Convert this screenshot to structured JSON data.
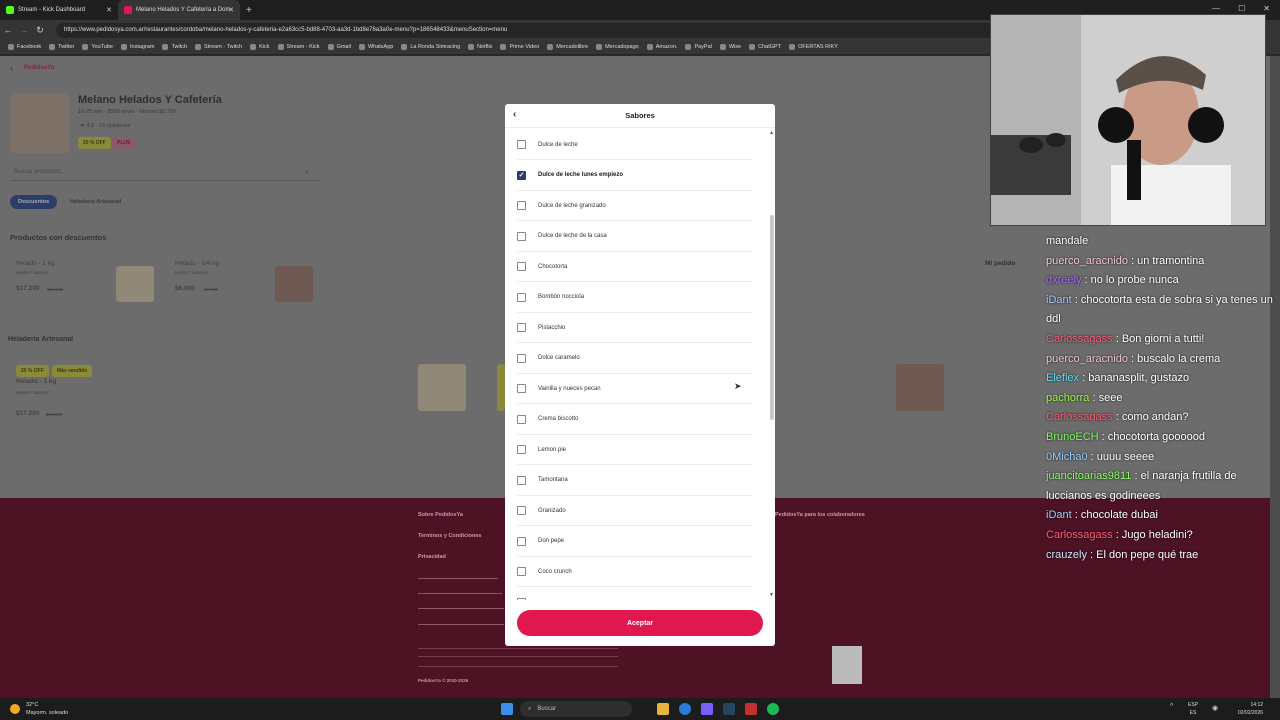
{
  "browser": {
    "tabs": [
      {
        "label": "Stream - Kick Dashboard",
        "active": false
      },
      {
        "label": "Melano Helados Y Cafetería a Dom",
        "active": true
      }
    ],
    "url": "https://www.pedidosya.com.ar/restaurantes/cordoba/melano-helados-y-cafeteria-e2a63cc5-bd88-4703-aa3d-1bd8e76a3a0e-menu?p=186548433&menuSection=menu",
    "bookmarks": [
      "Facebook",
      "Twitter",
      "YouTube",
      "Instagram",
      "Twitch",
      "Stream - Twitch",
      "Kick",
      "Stream - Kick",
      "Gmail",
      "WhatsApp",
      "La Ronda Simracing",
      "Netflix",
      "Prime Video",
      "Mercadolibre",
      "Mercadopago",
      "Amazon.",
      "PayPal",
      "Wise",
      "ChatGPT",
      "OFERTAS RIKY"
    ]
  },
  "store": {
    "brand": "PedidosYa",
    "name": "Melano Helados Y Cafetería",
    "meta": "10-25 min · $569 envío · Mínimo $5.799",
    "rating": "4.8",
    "reviews": "16 opiniones",
    "badge_off": "20 % OFF",
    "badge_plus": "PLUS",
    "search_placeholder": "Buscar productos...",
    "chips": [
      "Descuentos",
      "Heladería Artesanal"
    ],
    "section_discounts": "Productos con descuentos",
    "section_artesanal": "Heladería Artesanal",
    "mi_pedido": "Mi pedido",
    "products": [
      {
        "name": "Helado - 1 kg",
        "desc": "Hasta 4 sabores",
        "price": "$17.200",
        "old": "$21.500"
      },
      {
        "name": "Helado - 1/4 kg",
        "desc": "Hasta 2 sabores",
        "price": "$6.000",
        "old": "$7.500"
      }
    ],
    "artesanal_product": {
      "badge1": "20 % OFF",
      "badge2": "Más vendido",
      "name": "Helado - 1 kg",
      "desc": "Hasta 4 sabores",
      "price": "$17.200",
      "old": "$21.500"
    },
    "footer": {
      "links": [
        "Sobre PedidosYa",
        "Terminos y Condiciones",
        "Privacidad"
      ],
      "right_link": "PedidosYa para los colaboradores",
      "copyright": "PedidosYa © 2010-2026"
    }
  },
  "modal": {
    "title": "Sabores",
    "items": [
      {
        "label": "Dulce de leche",
        "checked": false
      },
      {
        "label": "Dulce de leche lunes empiezo",
        "checked": true
      },
      {
        "label": "Dulce de leche granizado",
        "checked": false
      },
      {
        "label": "Dulce de leche de la casa",
        "checked": false
      },
      {
        "label": "Chocotorta",
        "checked": false
      },
      {
        "label": "Bombón nocciola",
        "checked": false
      },
      {
        "label": "Pistacchio",
        "checked": false
      },
      {
        "label": "Dolce caramelo",
        "checked": false
      },
      {
        "label": "Vainilla y nueces pecan",
        "checked": false
      },
      {
        "label": "Crema biscotto",
        "checked": false
      },
      {
        "label": "Lemon pie",
        "checked": false
      },
      {
        "label": "Tamontana",
        "checked": false
      },
      {
        "label": "Granizado",
        "checked": false
      },
      {
        "label": "Don pepe",
        "checked": false
      },
      {
        "label": "Coco crunch",
        "checked": false
      }
    ],
    "accept_label": "Aceptar"
  },
  "chat": [
    {
      "user": "",
      "msg": "mandale",
      "color": "#ffffff"
    },
    {
      "user": "puerco_aracnido",
      "msg": "un tramontina",
      "color": "#f2c6d9"
    },
    {
      "user": "dxreely",
      "msg": "no lo probe nunca",
      "color": "#a56cff"
    },
    {
      "user": "iDant",
      "msg": "chocotorta esta de sobra si ya tenes un ddl",
      "color": "#9fd0ff"
    },
    {
      "user": "Carlossagass",
      "msg": "Bon giorni a tutti!",
      "color": "#ff5f7a"
    },
    {
      "user": "puerco_aracnido",
      "msg": "buscalo la crema",
      "color": "#f2c6d9"
    },
    {
      "user": "Eleflex",
      "msg": "bananasplit, gustazo",
      "color": "#5fe0ff"
    },
    {
      "user": "pachorra",
      "msg": "seee",
      "color": "#9dff4a"
    },
    {
      "user": "Carlossagass",
      "msg": "como andan?",
      "color": "#ff5f7a"
    },
    {
      "user": "BrunoECH",
      "msg": "chocotorta goooood",
      "color": "#7dff5f"
    },
    {
      "user": "0Micha0",
      "msg": "uuuu seeee",
      "color": "#9fd0ff"
    },
    {
      "user": "juancitoarias9811",
      "msg": "el naranja frutilla de luccianos es godineees",
      "color": "#8dff6a"
    },
    {
      "user": "iDant",
      "msg": "chocolate dubai",
      "color": "#9fd0ff"
    },
    {
      "user": "Carlossagass",
      "msg": "Jugo heladini?",
      "color": "#ff5f7a"
    },
    {
      "user": "crauzely",
      "msg": "El don pepe qué trae",
      "color": "#cfe6ff"
    }
  ],
  "taskbar": {
    "weather_temp": "32°C",
    "weather_desc": "Mayorm. soleado",
    "search": "Buscar",
    "lang1": "ESP",
    "lang2": "ES",
    "time": "14:12",
    "date": "02/02/2026"
  }
}
